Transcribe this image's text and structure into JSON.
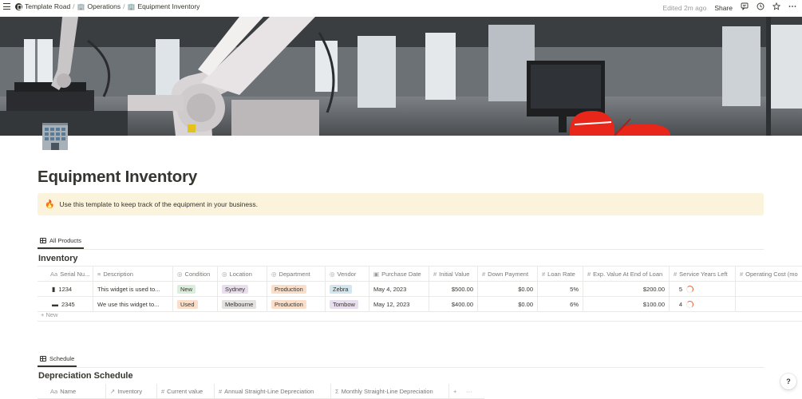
{
  "breadcrumbs": [
    {
      "label": "Template Road",
      "icon": "workspace-logo-icon"
    },
    {
      "label": "Operations",
      "icon": "building-icon"
    },
    {
      "label": "Equipment Inventory",
      "icon": "building-icon"
    }
  ],
  "topbar": {
    "edited": "Edited 2m ago",
    "share": "Share"
  },
  "page": {
    "title": "Equipment Inventory",
    "icon": "office-building-icon"
  },
  "callout": {
    "emoji": "🔥",
    "text": "Use this template to keep track of the equipment in your business."
  },
  "inventory": {
    "view_tab": "All Products",
    "title": "Inventory",
    "columns": [
      {
        "label": "Serial Nu...",
        "icon": "Aa"
      },
      {
        "label": "Description",
        "icon": "≡"
      },
      {
        "label": "Condition",
        "icon": "◎"
      },
      {
        "label": "Location",
        "icon": "◎"
      },
      {
        "label": "Department",
        "icon": "◎"
      },
      {
        "label": "Vendor",
        "icon": "◎"
      },
      {
        "label": "Purchase Date",
        "icon": "▣"
      },
      {
        "label": "Initial Value",
        "icon": "#"
      },
      {
        "label": "Down Payment",
        "icon": "#"
      },
      {
        "label": "Loan Rate",
        "icon": "#"
      },
      {
        "label": "Exp. Value At End of Loan",
        "icon": "#"
      },
      {
        "label": "Service Years Left",
        "icon": "#"
      },
      {
        "label": "Operating Cost (mo",
        "icon": "#"
      }
    ],
    "rows": [
      {
        "serial": "1234",
        "device_icon": "▮",
        "description": "This widget is used to...",
        "condition": "New",
        "location": "Sydney",
        "department": "Production",
        "vendor": "Zebra",
        "purchase_date": "May 4, 2023",
        "initial_value": "$500.00",
        "down_payment": "$0.00",
        "loan_rate": "5%",
        "exp_value": "$200.00",
        "service_years": "5"
      },
      {
        "serial": "2345",
        "device_icon": "▬",
        "description": "We use this widget to...",
        "condition": "Used",
        "location": "Melbourne",
        "department": "Production",
        "vendor": "Tombow",
        "purchase_date": "May 12, 2023",
        "initial_value": "$400.00",
        "down_payment": "$0.00",
        "loan_rate": "6%",
        "exp_value": "$100.00",
        "service_years": "4"
      }
    ],
    "new_label": "+ New"
  },
  "schedule": {
    "view_tab": "Schedule",
    "title": "Depreciation Schedule",
    "columns": [
      {
        "label": "Name",
        "icon": "Aa"
      },
      {
        "label": "Inventory",
        "icon": "↗"
      },
      {
        "label": "Current value",
        "icon": "#"
      },
      {
        "label": "Annual Straight-Line Depreciation",
        "icon": "#"
      },
      {
        "label": "Monthly Straight-Line Depreciation",
        "icon": "Σ"
      }
    ],
    "add": "+",
    "more": "···"
  },
  "help": "?",
  "colors": {
    "callout_bg": "#fbf3db",
    "accent_orange": "#e9622b",
    "text": "#37352f",
    "muted": "#787774"
  }
}
